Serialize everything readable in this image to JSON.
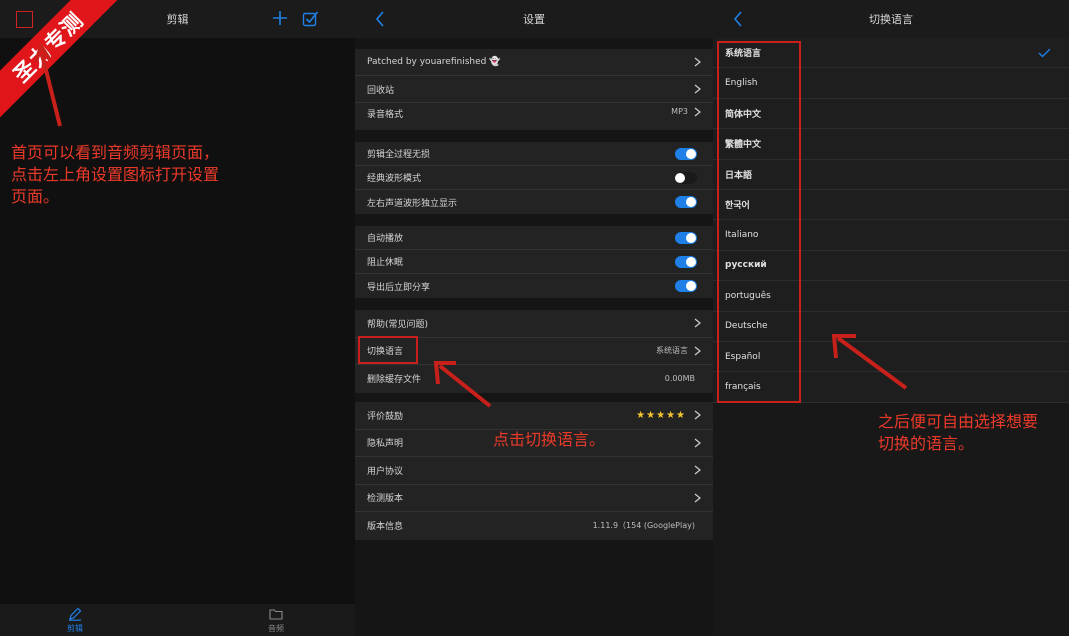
{
  "panel_edit": {
    "nav_title": "剪辑",
    "ribbon_text": "圣力专测",
    "annotation": "首页可以看到音频剪辑页面，点击左上角设置图标打开设置页面。",
    "tabs": [
      {
        "label": "剪辑",
        "icon": "pencil-icon"
      },
      {
        "label": "音频",
        "icon": "folder-icon"
      }
    ]
  },
  "panel_settings": {
    "nav_title": "设置",
    "group1": {
      "patched": "Patched by youarefinished 👻",
      "recycle": "回收站",
      "format_label": "录音格式",
      "format_value": "MP3"
    },
    "group2": {
      "full_lossless": "剪辑全过程无损",
      "classic_wave": "经典波形模式",
      "stereo_split": "左右声道波形独立显示"
    },
    "group3": {
      "autoplay": "自动播放",
      "no_sleep": "阻止休眠",
      "share_after_export": "导出后立即分享"
    },
    "group4": {
      "help": "帮助(常见问题)",
      "language": "切换语言",
      "language_value": "系统语言",
      "clear_cache": "删除缓存文件",
      "cache_size": "0.00MB"
    },
    "group5": {
      "rate": "评价鼓励",
      "stars": "★★★★★",
      "privacy": "隐私声明",
      "user_agreement": "用户协议",
      "check_version": "检测版本",
      "version_info": "版本信息",
      "version_value": "1.11.9（154 (GooglePlay)"
    },
    "annotation": "点击切换语言。"
  },
  "panel_language": {
    "nav_title": "切换语言",
    "languages": [
      "系统语言",
      "English",
      "简体中文",
      "繁體中文",
      "日本語",
      "한국어",
      "Italiano",
      "русский",
      "português",
      "Deutsche",
      "Español",
      "français"
    ],
    "annotation": "之后便可自由选择想要切换的语言。"
  },
  "colors": {
    "accent": "#1f80e8",
    "annotation_red": "#ec3a2a",
    "ribbon_red": "#e0161b"
  }
}
